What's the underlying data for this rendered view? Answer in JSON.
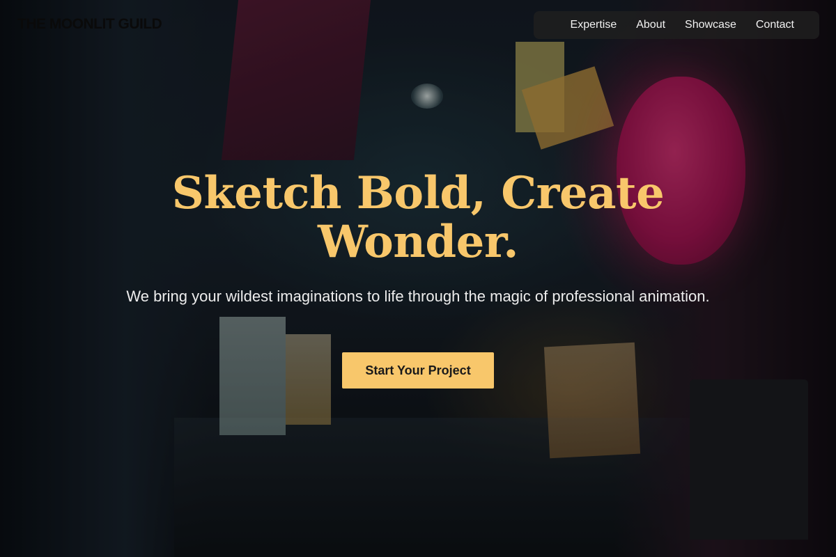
{
  "brand": {
    "name": "THE MOONLIT GUILD"
  },
  "nav": {
    "items": [
      {
        "label": "Expertise"
      },
      {
        "label": "About"
      },
      {
        "label": "Showcase"
      },
      {
        "label": "Contact"
      }
    ]
  },
  "hero": {
    "headline": "Sketch Bold, Create Wonder.",
    "subtitle": "We bring your wildest imaginations to life through the magic of professional animation.",
    "cta_label": "Start Your Project",
    "background": "night-alley-photo"
  },
  "colors": {
    "accent": "#f8c76b",
    "nav_background": "#1e1e1e",
    "text_light": "#ededed",
    "logo_text": "#0a0a0a"
  }
}
